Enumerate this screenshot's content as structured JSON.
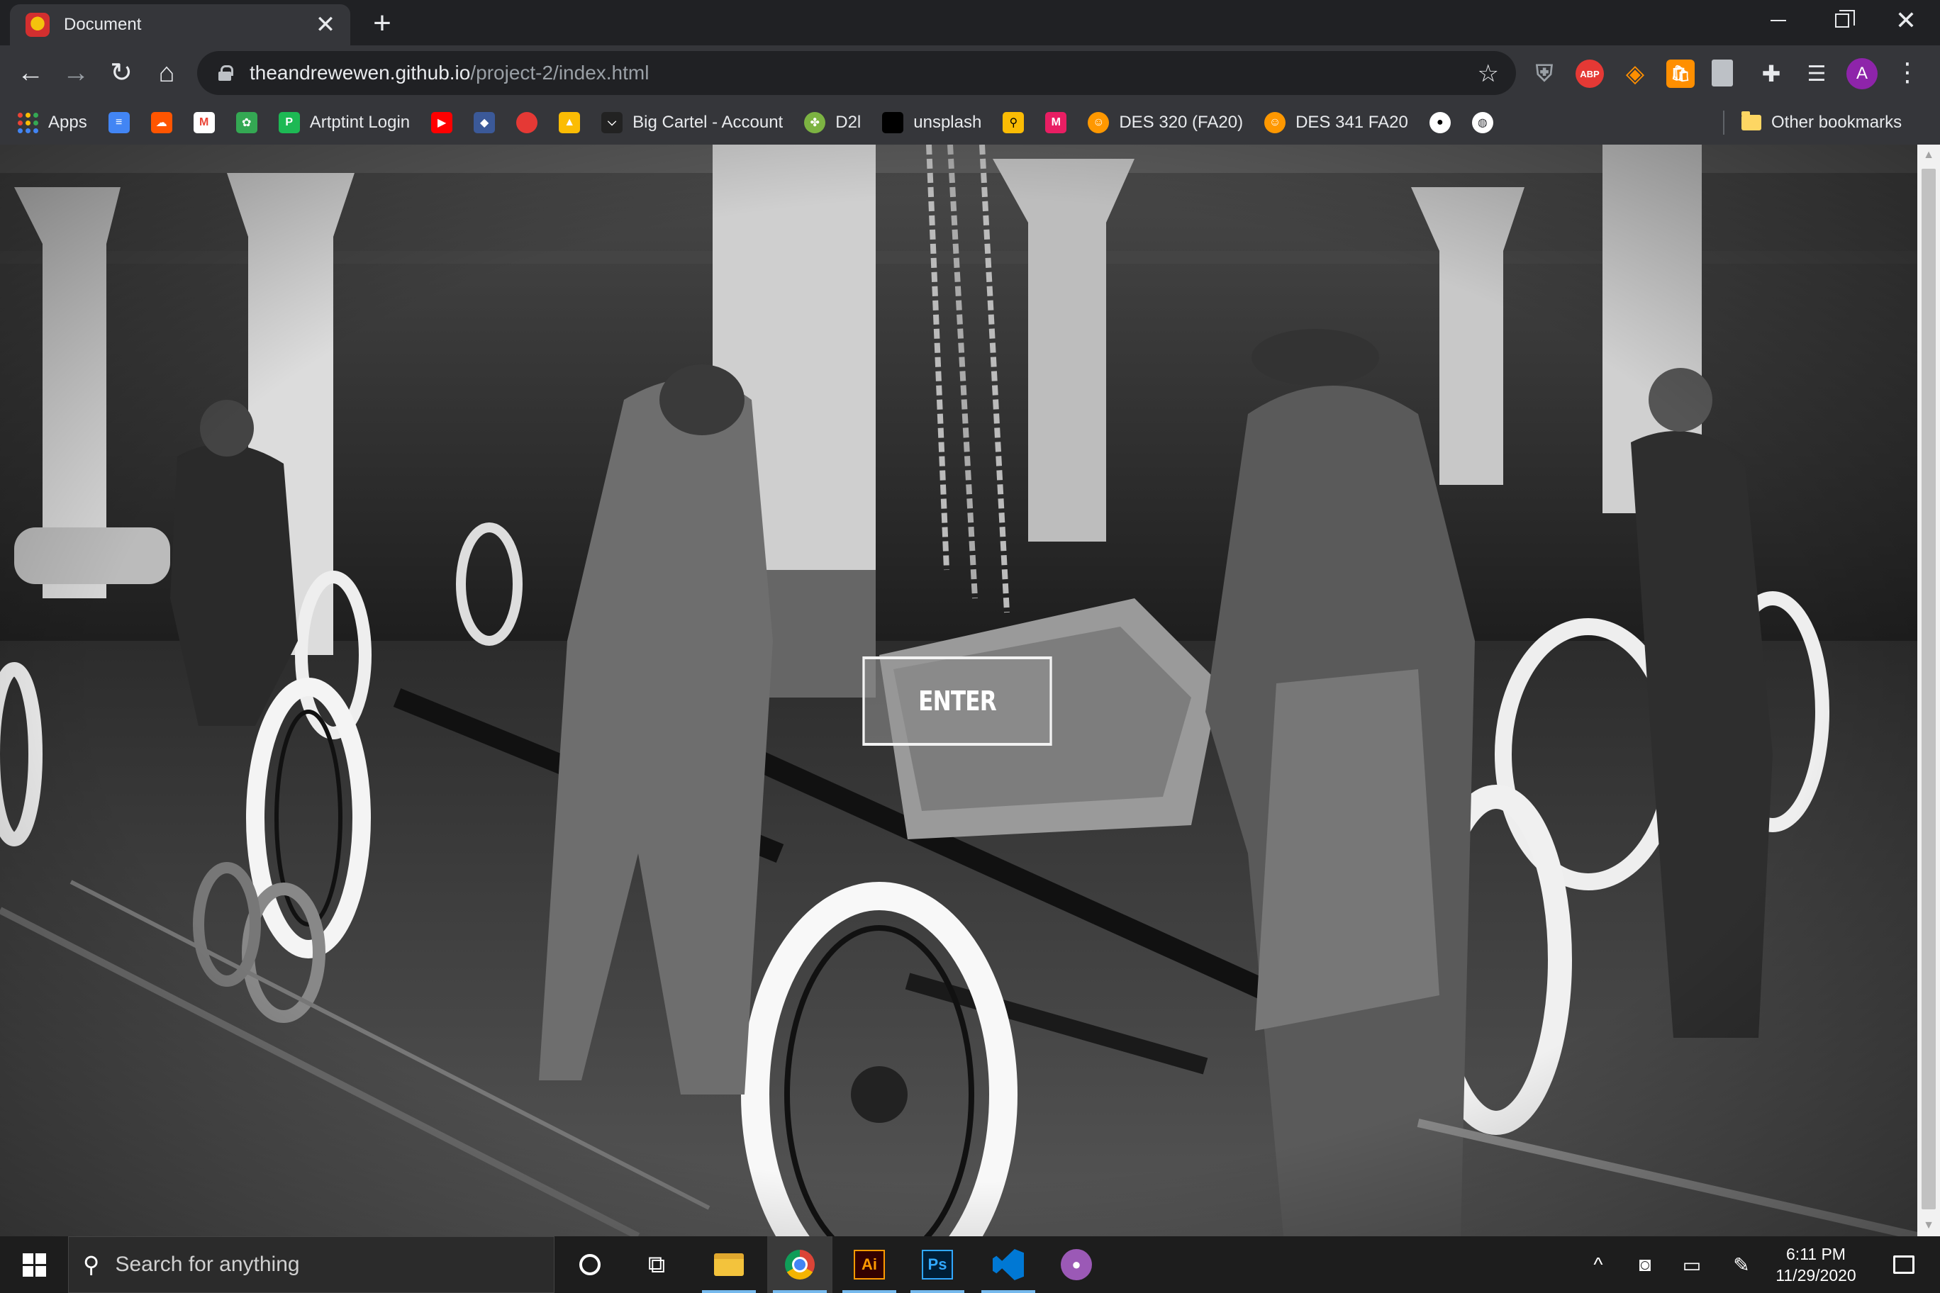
{
  "browser": {
    "tab": {
      "title": "Document",
      "close_glyph": "✕"
    },
    "new_tab_glyph": "+",
    "window_controls": {
      "minimize": "minimize-icon",
      "restore": "restore-icon",
      "close_glyph": "✕"
    },
    "url_host": "theandrewewen.github.io",
    "url_path": "/project-2/index.html",
    "extensions": {
      "abp_label": "ABP"
    },
    "profile_initial": "A"
  },
  "bookmarks": {
    "items": [
      {
        "label": "Apps",
        "icon": "apps-grid-icon"
      },
      {
        "label": "",
        "icon": "google-docs-icon",
        "color": "#4285f4"
      },
      {
        "label": "",
        "icon": "soundcloud-icon",
        "color": "#ff5500"
      },
      {
        "label": "",
        "icon": "gmail-icon",
        "color": "#ea4335"
      },
      {
        "label": "",
        "icon": "green-logo-icon",
        "color": "#34a853"
      },
      {
        "label": "Artptint Login",
        "icon": "artptint-icon",
        "color": "#1db954"
      },
      {
        "label": "",
        "icon": "youtube-icon",
        "color": "#ff0000"
      },
      {
        "label": "",
        "icon": "blue-diamond-icon",
        "color": "#3b5998"
      },
      {
        "label": "",
        "icon": "multicolor-blob-icon",
        "color": "#e53935"
      },
      {
        "label": "",
        "icon": "google-drive-icon",
        "color": "#fbbc04"
      },
      {
        "label": "Big Cartel - Account",
        "icon": "big-cartel-icon",
        "color": "#222222"
      },
      {
        "label": "D2l",
        "icon": "d2l-icon",
        "color": "#7cb342"
      },
      {
        "label": "unsplash",
        "icon": "unsplash-icon",
        "color": "#000000"
      },
      {
        "label": "",
        "icon": "search-magnifier-icon",
        "color": "#fbbc04"
      },
      {
        "label": "",
        "icon": "m-badge-icon",
        "color": "#e91e63"
      },
      {
        "label": "DES 320 (FA20)",
        "icon": "course-emoji-icon",
        "color": "#ff9800"
      },
      {
        "label": "DES 341 FA20",
        "icon": "course-emoji-icon",
        "color": "#ff9800"
      },
      {
        "label": "",
        "icon": "github-icon",
        "color": "#ffffff"
      },
      {
        "label": "",
        "icon": "globe-icon",
        "color": "#ffffff"
      }
    ],
    "other_label": "Other bookmarks"
  },
  "page": {
    "enter_label": "ENTER",
    "background_description_icon": "factory-photo"
  },
  "taskbar": {
    "search_placeholder": "Search for anything",
    "apps": [
      {
        "name": "cortana",
        "icon": "cortana-icon"
      },
      {
        "name": "task-view",
        "icon": "task-view-icon"
      },
      {
        "name": "file-explorer",
        "icon": "folder-icon"
      },
      {
        "name": "chrome",
        "icon": "chrome-icon"
      },
      {
        "name": "illustrator",
        "icon": "illustrator-icon",
        "label": "Ai"
      },
      {
        "name": "photoshop",
        "icon": "photoshop-icon",
        "label": "Ps"
      },
      {
        "name": "vscode",
        "icon": "vscode-icon"
      },
      {
        "name": "github-desktop",
        "icon": "github-desktop-icon"
      }
    ],
    "time": "6:11 PM",
    "date": "11/29/2020"
  }
}
